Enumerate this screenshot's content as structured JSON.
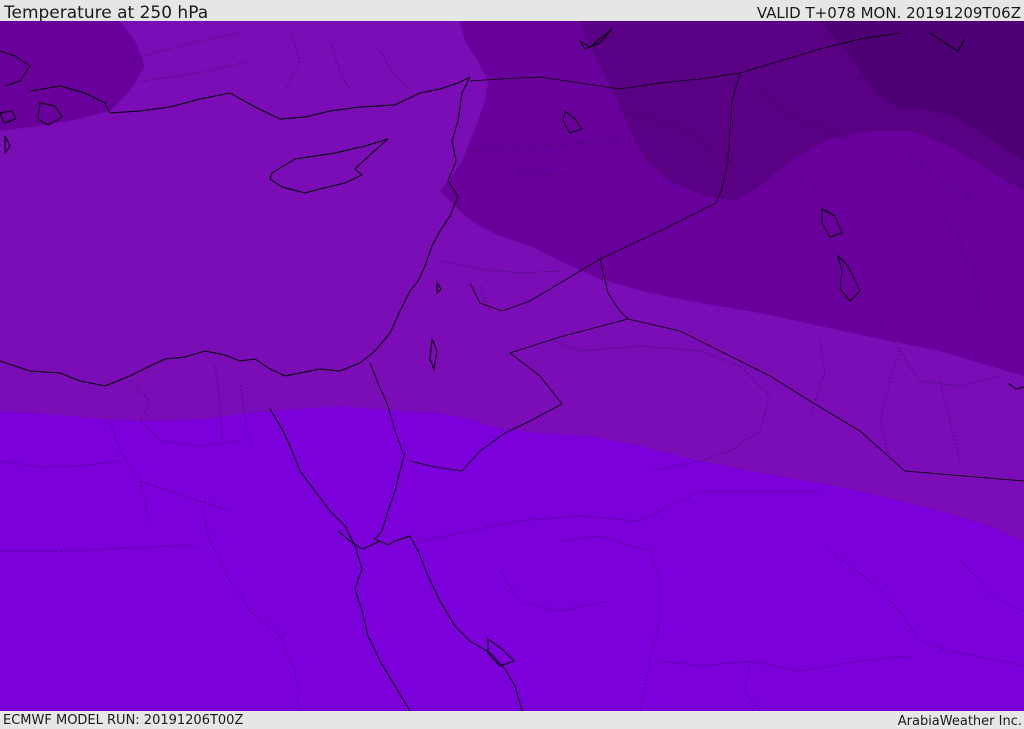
{
  "header": {
    "title": "Temperature at 250 hPa",
    "valid": "VALID T+078 MON. 20191209T06Z"
  },
  "footer": {
    "model_run": "ECMWF MODEL RUN: 20191206T00Z",
    "credit": "ArabiaWeather Inc."
  },
  "colors": {
    "bar_background": "#e6e6e6",
    "band_warmest": "#7b00d9",
    "band_warm": "#7a0db5",
    "band_mid": "#6a009c",
    "band_cold": "#5a0085",
    "band_coldest": "#4d0073",
    "coastline": "#000000"
  }
}
